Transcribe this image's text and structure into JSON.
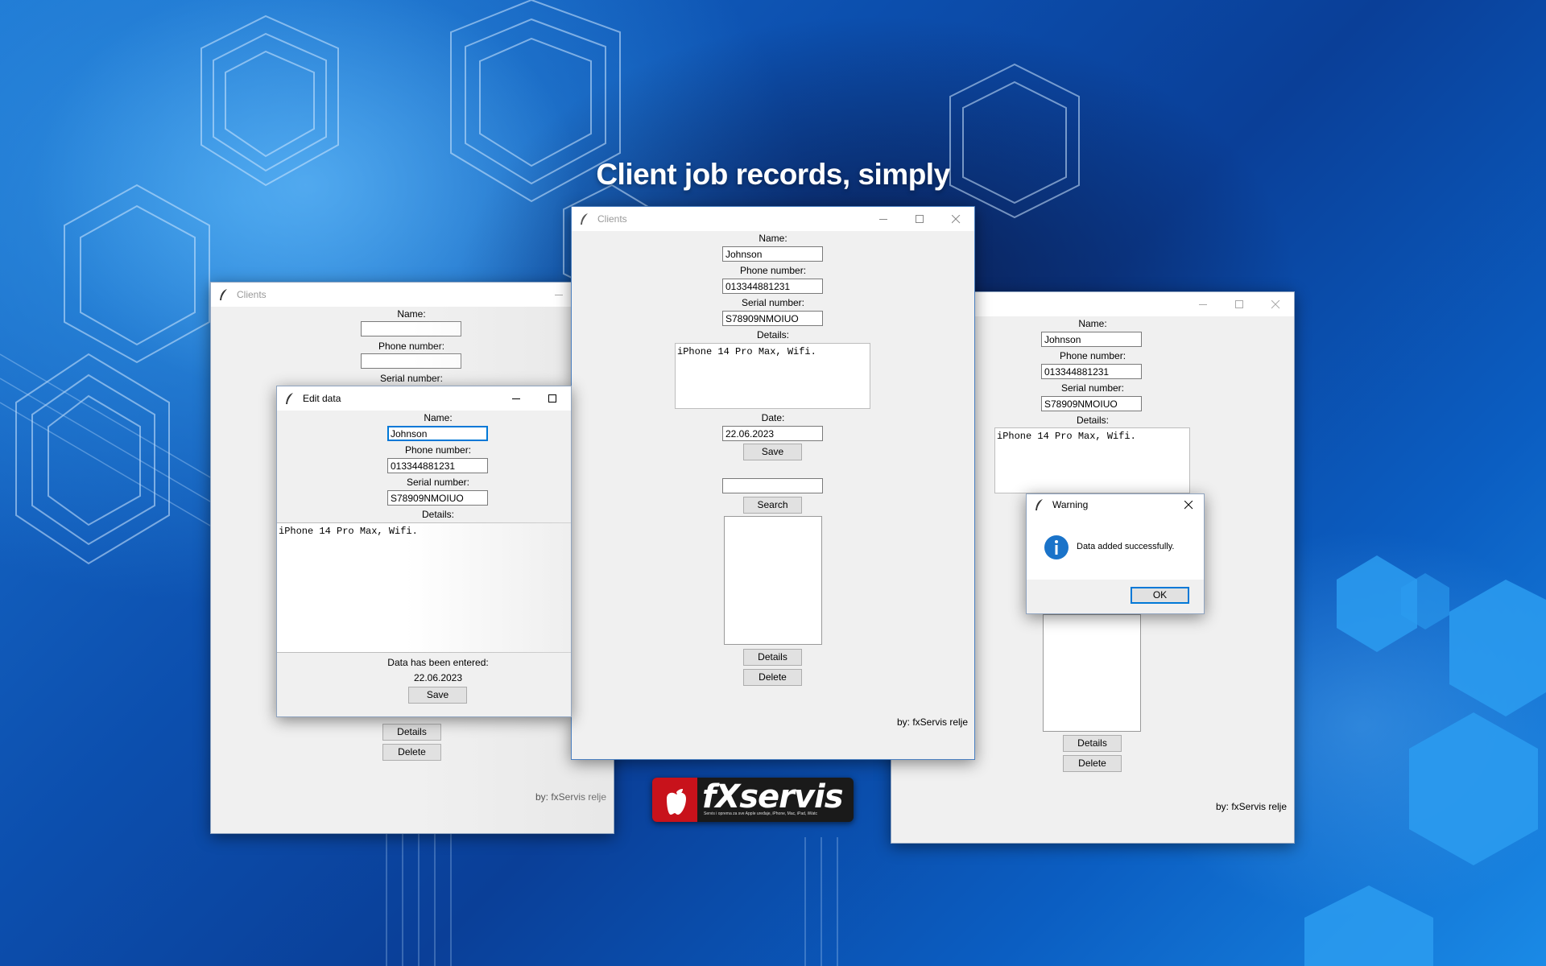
{
  "headline": "Client job records, simply",
  "windows": {
    "clients_left": {
      "title": "Clients",
      "name_label": "Name:",
      "name_value": "",
      "phone_label": "Phone number:",
      "phone_value": "",
      "serial_label": "Serial number:",
      "details_button": "Details",
      "delete_button": "Delete",
      "credit": "by: fxServis relje"
    },
    "edit_data": {
      "title": "Edit data",
      "name_label": "Name:",
      "name_value": "Johnson",
      "phone_label": "Phone number:",
      "phone_value": "013344881231",
      "serial_label": "Serial number:",
      "serial_value": "S78909NMOIUO",
      "details_label": "Details:",
      "details_text": "iPhone 14 Pro Max, Wifi.",
      "entered_label": "Data has been entered:",
      "entered_date": "22.06.2023",
      "save_button": "Save"
    },
    "clients_center": {
      "title": "Clients",
      "name_label": "Name:",
      "name_value": "Johnson",
      "phone_label": "Phone number:",
      "phone_value": "013344881231",
      "serial_label": "Serial number:",
      "serial_value": "S78909NMOIUO",
      "details_label": "Details:",
      "details_text": "iPhone 14 Pro Max, Wifi.",
      "date_label": "Date:",
      "date_value": "22.06.2023",
      "save_button": "Save",
      "search_value": "",
      "search_button": "Search",
      "details_button": "Details",
      "delete_button": "Delete",
      "credit": "by: fxServis relje"
    },
    "clients_right": {
      "name_label": "Name:",
      "name_value": "Johnson",
      "phone_label": "Phone number:",
      "phone_value": "013344881231",
      "serial_label": "Serial number:",
      "serial_value": "S78909NMOIUO",
      "details_label": "Details:",
      "details_text": "iPhone 14 Pro Max, Wifi.",
      "details_button": "Details",
      "delete_button": "Delete",
      "credit": "by: fxServis relje"
    },
    "warning": {
      "title": "Warning",
      "message": "Data added successfully.",
      "ok_button": "OK",
      "icon": "info-icon"
    }
  },
  "logo": {
    "brand": "fXservis",
    "tagline": "Servis i oprema za sve Apple uređaje, iPhone, Mac, iPad, iWatc"
  },
  "colors": {
    "accent": "#0078d7",
    "logo_red": "#d0121b",
    "info_blue": "#1a73c9"
  }
}
